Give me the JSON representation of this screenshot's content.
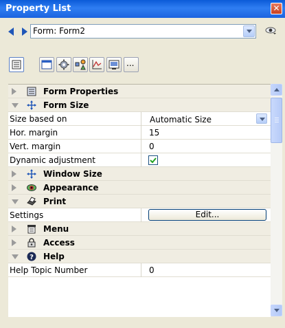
{
  "window": {
    "title": "Property List",
    "close_glyph": "✕"
  },
  "object_selector": {
    "value": "Form: Form2"
  },
  "toolbar": {
    "tabs": [
      "list-icon",
      "form-icon",
      "gear-icon",
      "object-tree-icon",
      "chart-icon",
      "window-icon",
      "more-icon"
    ],
    "more_label": "..."
  },
  "properties": {
    "form_properties": "Form Properties",
    "form_size": "Form Size",
    "size_based_on_label": "Size based on",
    "size_based_on_value": "Automatic Size",
    "hor_margin_label": "Hor. margin",
    "hor_margin_value": "15",
    "vert_margin_label": "Vert. margin",
    "vert_margin_value": "0",
    "dynamic_adjustment_label": "Dynamic adjustment",
    "dynamic_adjustment_checked": true,
    "window_size": "Window Size",
    "appearance": "Appearance",
    "print": "Print",
    "settings_label": "Settings",
    "settings_button": "Edit...",
    "menu": "Menu",
    "access": "Access",
    "help": "Help",
    "help_topic_label": "Help Topic Number",
    "help_topic_value": "0"
  }
}
